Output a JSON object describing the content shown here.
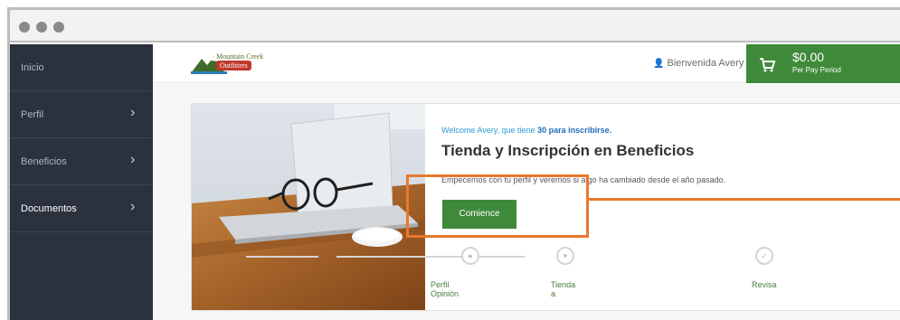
{
  "sidebar": {
    "items": [
      {
        "label": "Inicio"
      },
      {
        "label": "Perfil"
      },
      {
        "label": "Beneficios"
      },
      {
        "label": "Documentos"
      }
    ]
  },
  "topbar": {
    "logo_line1": "Mountain Creek",
    "logo_line2": "Outfitters",
    "user_greeting": "Bienvenida Avery ⌄",
    "cart_amount": "$0.00",
    "cart_sub": "Per Pay Period"
  },
  "main": {
    "welcome_prefix": "Welcome Avery, que tiene ",
    "welcome_count": "30 para inscribirse.",
    "heading": "Tienda y Inscripción en Beneficios",
    "lead": "Empecemos con tu perfil y veremos si algo ha cambiado desde el año pasado.",
    "button": "Comience"
  },
  "steps": [
    {
      "label": "Perfil Opinión",
      "icon": "person-icon"
    },
    {
      "label": "Tienda a",
      "icon": "cart-icon"
    },
    {
      "label": "Revisa",
      "icon": "check-icon"
    }
  ],
  "colors": {
    "accent_green": "#3f8a3a",
    "sidebar_bg": "#2b323e",
    "highlight_orange": "#e8792d",
    "link_blue": "#2a9bd6"
  }
}
